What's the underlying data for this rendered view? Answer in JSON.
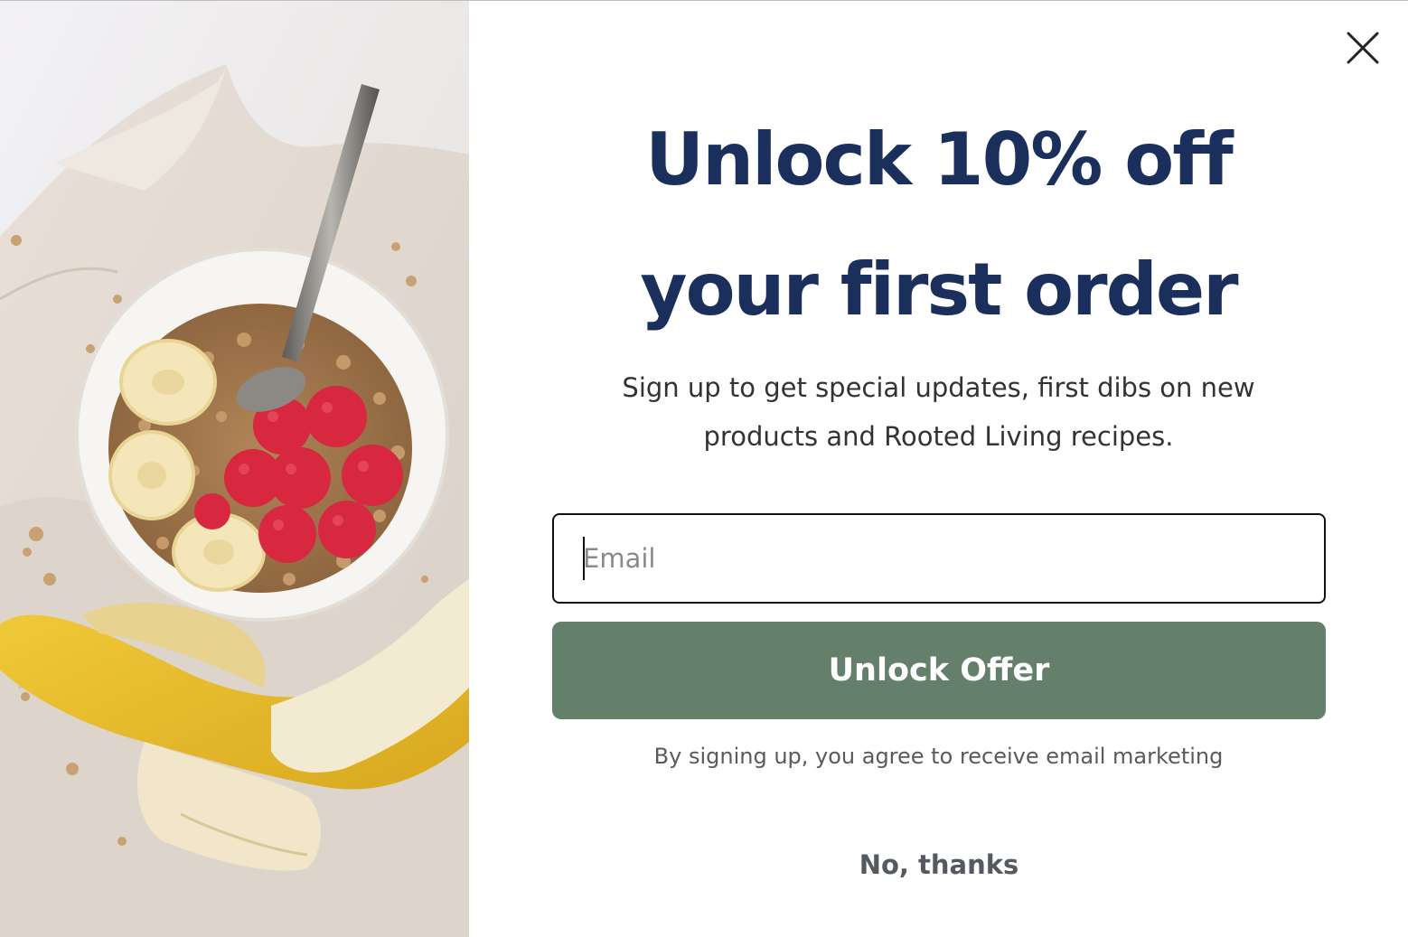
{
  "popup": {
    "headline_line1": "Unlock 10% off",
    "headline_line2": "your first order",
    "subtext_line1": "Sign up to get special updates, first dibs on new",
    "subtext_line2": "products and Rooted Living recipes.",
    "email_placeholder": "Email",
    "email_value": "",
    "cta_label": "Unlock Offer",
    "disclaimer": "By signing up, you agree to receive email marketing",
    "dismiss_label": "No, thanks",
    "close_icon": "close-icon",
    "hero_image": "granola bowl with raspberries and sliced banana beside a peeled banana"
  },
  "colors": {
    "headline": "#1b2f5c",
    "cta_background": "#64806a",
    "cta_text": "#ffffff",
    "body_text": "#333333",
    "muted_text": "#5a5a5a"
  }
}
